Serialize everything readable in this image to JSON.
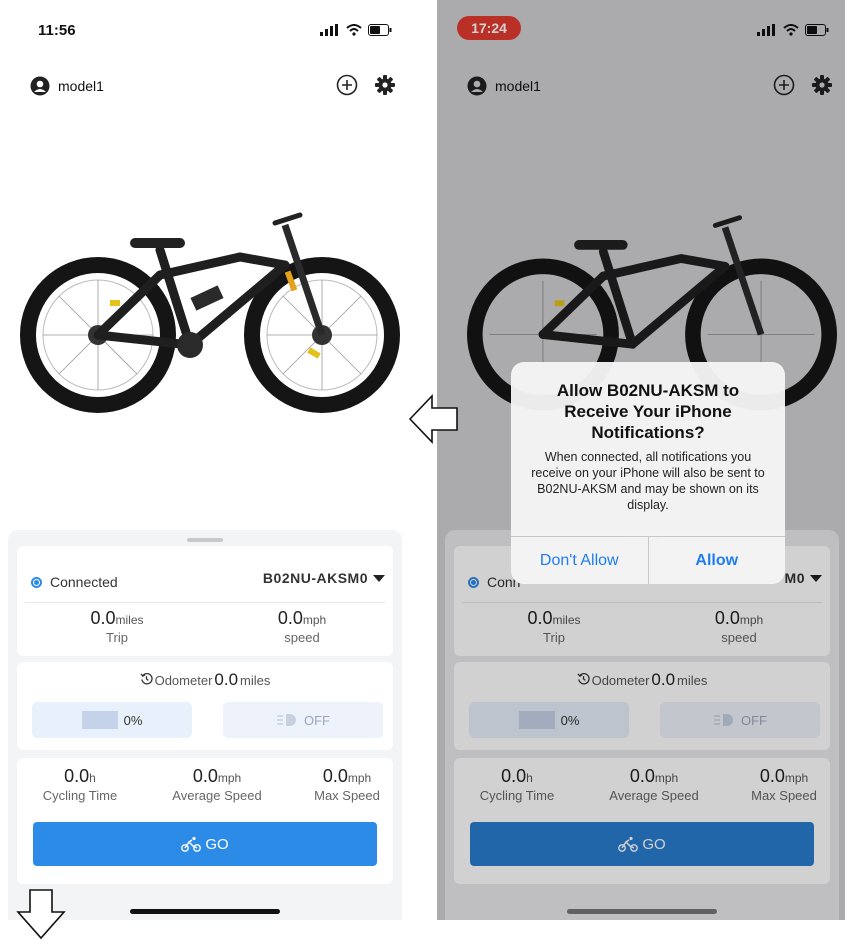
{
  "left": {
    "time": "11:56",
    "user": "model1",
    "connection": "Connected",
    "device": "B02NU-AKSM0",
    "trip": {
      "value": "0.0",
      "unit": "miles",
      "label": "Trip"
    },
    "speed": {
      "value": "0.0",
      "unit": "mph",
      "label": "speed"
    },
    "odometer": {
      "label": "Odometer",
      "value": "0.0",
      "unit": "miles"
    },
    "battery": "0%",
    "light": "OFF",
    "cycling_time": {
      "value": "0.0",
      "unit": "h",
      "label": "Cycling Time"
    },
    "avg_speed": {
      "value": "0.0",
      "unit": "mph",
      "label": "Average Speed"
    },
    "max_speed": {
      "value": "0.0",
      "unit": "mph",
      "label": "Max Speed"
    },
    "go": "GO"
  },
  "right": {
    "time": "17:24",
    "user": "model1",
    "connection": "Conn",
    "device": "M0",
    "trip": {
      "value": "0.0",
      "unit": "miles",
      "label": "Trip"
    },
    "speed": {
      "value": "0.0",
      "unit": "mph",
      "label": "speed"
    },
    "odometer": {
      "label": "Odometer",
      "value": "0.0",
      "unit": "miles"
    },
    "battery": "0%",
    "light": "OFF",
    "cycling_time": {
      "value": "0.0",
      "unit": "h",
      "label": "Cycling Time"
    },
    "avg_speed": {
      "value": "0.0",
      "unit": "mph",
      "label": "Average Speed"
    },
    "max_speed": {
      "value": "0.0",
      "unit": "mph",
      "label": "Max Speed"
    },
    "go": "GO"
  },
  "alert": {
    "title": "Allow B02NU-AKSM to Receive Your iPhone Notifications?",
    "message": "When connected, all notifications you receive on your iPhone will also be sent to B02NU-AKSM and may be shown on its display.",
    "deny": "Don't Allow",
    "allow": "Allow"
  },
  "colors": {
    "accent": "#2d8be8",
    "ios_blue": "#1e7df0",
    "recording": "#e53b2f"
  }
}
